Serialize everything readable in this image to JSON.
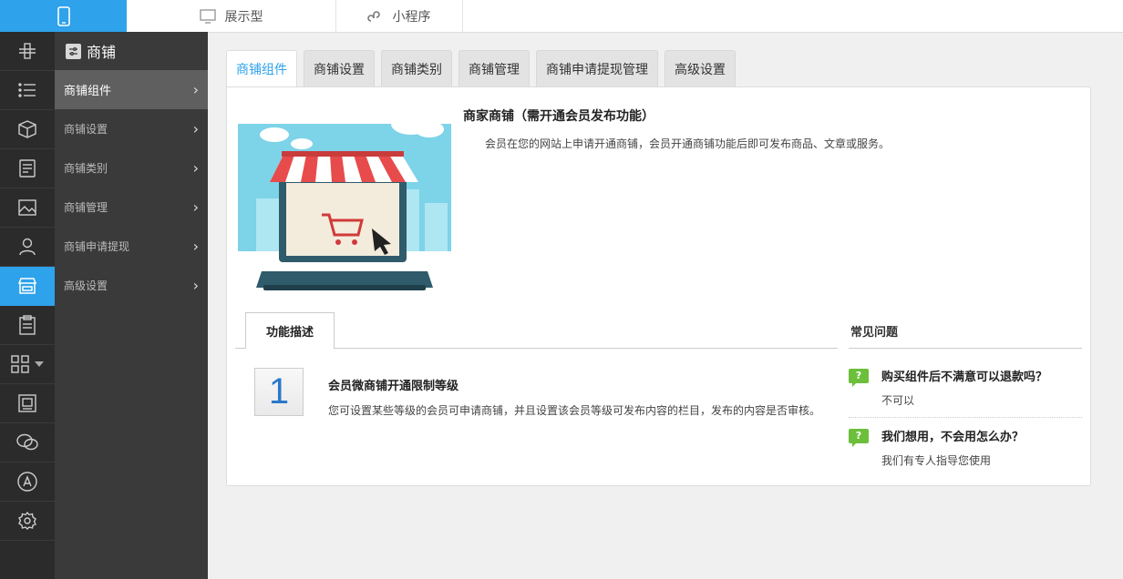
{
  "topbar": {
    "tabs": [
      {
        "label": "展示型",
        "icon": "monitor-icon"
      },
      {
        "label": "小程序",
        "icon": "mini-program-icon"
      }
    ]
  },
  "rail": {
    "icons": [
      "drone-icon",
      "list-icon",
      "cube-icon",
      "document-icon",
      "image-icon",
      "user-icon",
      "store-icon",
      "clipboard-icon",
      "grid-icon",
      "frame-icon",
      "wechat-icon",
      "app-store-icon",
      "gear-icon"
    ],
    "active": "store-icon"
  },
  "menu": {
    "title": "商铺",
    "items": [
      {
        "label": "商铺组件",
        "active": true
      },
      {
        "label": "商铺设置"
      },
      {
        "label": "商铺类别"
      },
      {
        "label": "商铺管理"
      },
      {
        "label": "商铺申请提现"
      },
      {
        "label": "高级设置"
      }
    ]
  },
  "tabs": [
    "商铺组件",
    "商铺设置",
    "商铺类别",
    "商铺管理",
    "商铺申请提现管理",
    "高级设置"
  ],
  "intro": {
    "title": "商家商铺（需开通会员发布功能）",
    "desc": "会员在您的网站上申请开通商铺，会员开通商铺功能后即可发布商品、文章或服务。"
  },
  "feature": {
    "tab_label": "功能描述",
    "number": "1",
    "title": "会员微商铺开通限制等级",
    "desc": "您可设置某些等级的会员可申请商铺，并且设置该会员等级可发布内容的栏目，发布的内容是否审核。"
  },
  "faq": {
    "title": "常见问题",
    "items": [
      {
        "q": "购买组件后不满意可以退款吗？",
        "a": "不可以"
      },
      {
        "q": "我们想用，不会用怎么办？",
        "a": "我们有专人指导您使用"
      }
    ],
    "icon_glyph": "?"
  },
  "colors": {
    "accent": "#2ea2ea",
    "rail": "#2b2b2b",
    "menu": "#3a3a3a",
    "faq_icon": "#6cbf3b"
  }
}
